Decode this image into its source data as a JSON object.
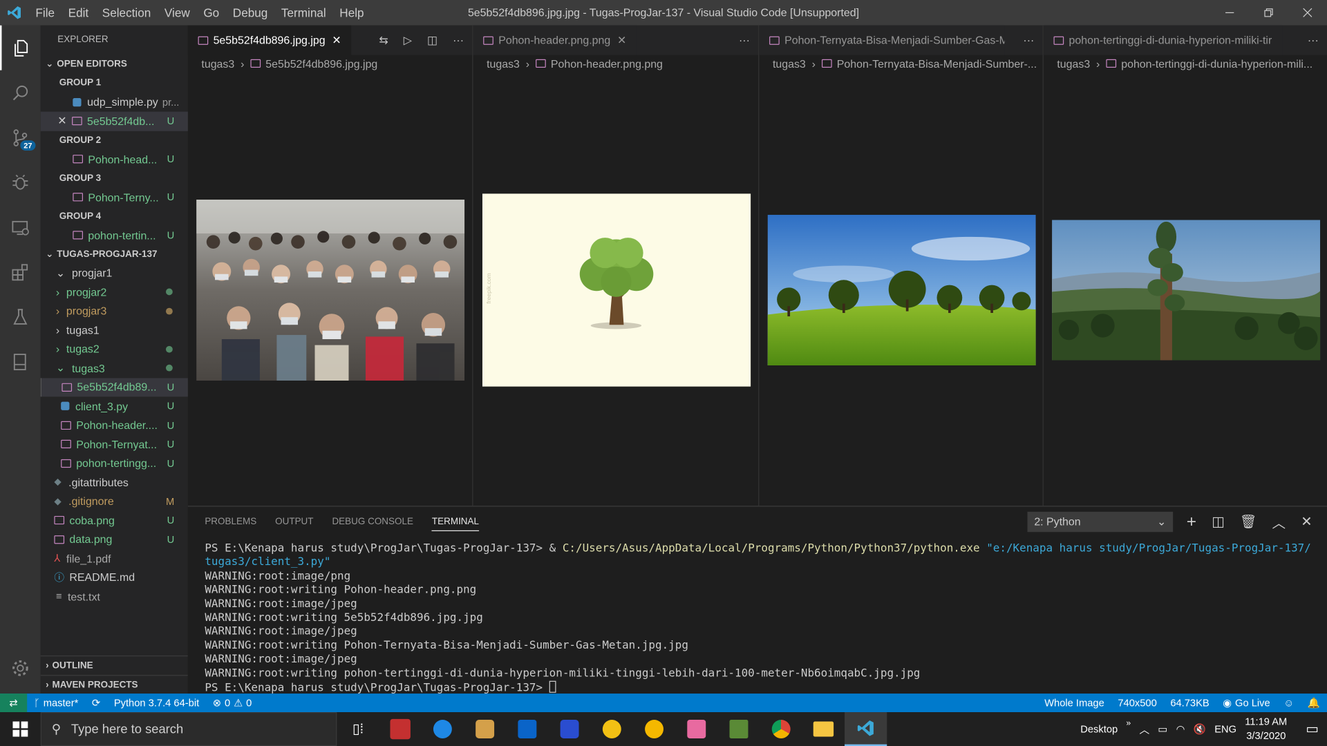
{
  "window": {
    "title": "5e5b52f4db896.jpg.jpg - Tugas-ProgJar-137 - Visual Studio Code [Unsupported]",
    "menu": [
      "File",
      "Edit",
      "Selection",
      "View",
      "Go",
      "Debug",
      "Terminal",
      "Help"
    ]
  },
  "activity_bar": {
    "scm_badge": "27"
  },
  "sidebar": {
    "header": "EXPLORER",
    "open_editors_title": "OPEN EDITORS",
    "groups": [
      {
        "name": "GROUP 1",
        "files": [
          {
            "name": "udp_simple.py",
            "extra": "pr...",
            "status": ""
          },
          {
            "name": "5e5b52f4db...",
            "status": "U"
          }
        ]
      },
      {
        "name": "GROUP 2",
        "files": [
          {
            "name": "Pohon-head...",
            "status": "U"
          }
        ]
      },
      {
        "name": "GROUP 3",
        "files": [
          {
            "name": "Pohon-Terny...",
            "status": "U"
          }
        ]
      },
      {
        "name": "GROUP 4",
        "files": [
          {
            "name": "pohon-tertin...",
            "status": "U"
          }
        ]
      }
    ],
    "project_title": "TUGAS-PROGJAR-137",
    "tree": [
      {
        "name": "progjar1",
        "status": ""
      },
      {
        "name": "progjar2",
        "status": ""
      },
      {
        "name": "progjar3",
        "status": ""
      },
      {
        "name": "tugas1",
        "status": ""
      },
      {
        "name": "tugas2",
        "status": ""
      },
      {
        "name": "tugas3",
        "status": ""
      },
      {
        "name": "5e5b52f4db89...",
        "status": "U"
      },
      {
        "name": "client_3.py",
        "status": "U"
      },
      {
        "name": "Pohon-header....",
        "status": "U"
      },
      {
        "name": "Pohon-Ternyat...",
        "status": "U"
      },
      {
        "name": "pohon-tertingg...",
        "status": "U"
      },
      {
        "name": ".gitattributes",
        "status": ""
      },
      {
        "name": ".gitignore",
        "status": "M"
      },
      {
        "name": "coba.png",
        "status": "U"
      },
      {
        "name": "data.png",
        "status": "U"
      },
      {
        "name": "file_1.pdf",
        "status": ""
      },
      {
        "name": "README.md",
        "status": ""
      },
      {
        "name": "test.txt",
        "status": ""
      }
    ],
    "outline": "OUTLINE",
    "maven": "MAVEN PROJECTS"
  },
  "editors": [
    {
      "tab": "5e5b52f4db896.jpg.jpg",
      "crumb_folder": "tugas3",
      "crumb_file": "5e5b52f4db896.jpg.jpg"
    },
    {
      "tab": "Pohon-header.png.png",
      "crumb_folder": "tugas3",
      "crumb_file": "Pohon-header.png.png"
    },
    {
      "tab": "Pohon-Ternyata-Bisa-Menjadi-Sumber-Gas-M",
      "crumb_folder": "tugas3",
      "crumb_file": "Pohon-Ternyata-Bisa-Menjadi-Sumber-..."
    },
    {
      "tab": "pohon-tertinggi-di-dunia-hyperion-miliki-tir",
      "crumb_folder": "tugas3",
      "crumb_file": "pohon-tertinggi-di-dunia-hyperion-mili..."
    }
  ],
  "panel": {
    "tabs": [
      "PROBLEMS",
      "OUTPUT",
      "DEBUG CONSOLE",
      "TERMINAL"
    ],
    "terminal_select": "2: Python",
    "terminal": {
      "prompt1": "PS E:\\Kenapa harus study\\ProgJar\\Tugas-ProgJar-137> & ",
      "exe": "C:/Users/Asus/AppData/Local/Programs/Python/Python37/python.exe",
      "arg": " \"e:/Kenapa harus study/ProgJar/Tugas-ProgJar-137/tugas3/client_3.py\"",
      "lines": [
        "WARNING:root:image/png",
        "WARNING:root:writing Pohon-header.png.png",
        "WARNING:root:image/jpeg",
        "WARNING:root:writing 5e5b52f4db896.jpg.jpg",
        "WARNING:root:image/jpeg",
        "WARNING:root:writing Pohon-Ternyata-Bisa-Menjadi-Sumber-Gas-Metan.jpg.jpg",
        "WARNING:root:image/jpeg",
        "WARNING:root:writing pohon-tertinggi-di-dunia-hyperion-miliki-tinggi-lebih-dari-100-meter-Nb6oimqabC.jpg.jpg"
      ],
      "prompt2": "PS E:\\Kenapa harus study\\ProgJar\\Tugas-ProgJar-137> "
    }
  },
  "statusbar": {
    "branch": "master*",
    "python": "Python 3.7.4 64-bit",
    "errors": "0",
    "warnings": "0",
    "whole_image": "Whole Image",
    "dimensions": "740x500",
    "size": "64.73KB",
    "golive": "Go Live"
  },
  "taskbar": {
    "search_placeholder": "Type here to search",
    "desktop": "Desktop",
    "lang": "ENG",
    "time": "11:19 AM",
    "date": "3/3/2020"
  },
  "colors": {
    "accent": "#007acc",
    "remote": "#16825d",
    "untracked": "#73c991",
    "modified": "#c19c5f"
  }
}
